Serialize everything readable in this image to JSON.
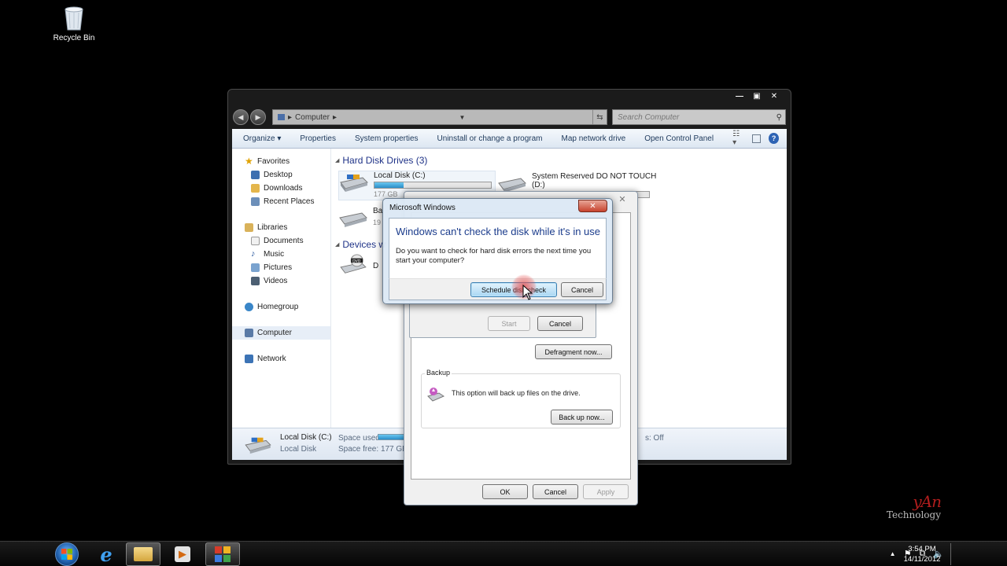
{
  "desktop": {
    "recycle_bin_label": "Recycle Bin"
  },
  "explorer": {
    "address": "Computer",
    "search_placeholder": "Search Computer",
    "toolbar": [
      "Organize ▾",
      "Properties",
      "System properties",
      "Uninstall or change a program",
      "Map network drive",
      "Open Control Panel"
    ],
    "nav": {
      "favorites": "Favorites",
      "favorites_items": [
        "Desktop",
        "Downloads",
        "Recent Places"
      ],
      "libraries": "Libraries",
      "libraries_items": [
        "Documents",
        "Music",
        "Pictures",
        "Videos"
      ],
      "homegroup": "Homegroup",
      "computer": "Computer",
      "network": "Network"
    },
    "hard_disk_header": "Hard Disk Drives (3)",
    "drives": [
      {
        "name": "Local Disk (C:)",
        "size_text": "177 GB",
        "fill": 0.25
      },
      {
        "name": "System Reserved DO NOT TOUCH",
        "letter": "(D:)",
        "fill": 0.7
      },
      {
        "name_partial": "Ba",
        "size_partial": "19"
      }
    ],
    "devices_header": "Devices w",
    "device_partial": "D",
    "details": {
      "name": "Local Disk (C:)",
      "type": "Local Disk",
      "space_used_label": "Space used:",
      "space_free_label": "Space free:",
      "space_free_value": "177 GB",
      "extra": "s: Off"
    }
  },
  "properties_dialog": {
    "start_label": "Start",
    "cancel_label": "Cancel",
    "defrag_label": "Defragment now...",
    "backup_group": "Backup",
    "backup_text": "This option will back up files on the drive.",
    "backup_button": "Back up now...",
    "ok_label": "OK",
    "cancel2_label": "Cancel",
    "apply_label": "Apply"
  },
  "message_box": {
    "title": "Microsoft Windows",
    "heading": "Windows can't check the disk while it's in use",
    "body": "Do you want to check for hard disk errors the next time you start your computer?",
    "primary_button": "Schedule disk check",
    "cancel_button": "Cancel"
  },
  "watermark": {
    "line1": "yAn",
    "line2": "Technology"
  },
  "taskbar": {
    "time": "3:54 PM",
    "date": "14/11/2012"
  },
  "colors": {
    "heading_blue": "#1b3c8c",
    "accent": "#2b8ec8"
  }
}
